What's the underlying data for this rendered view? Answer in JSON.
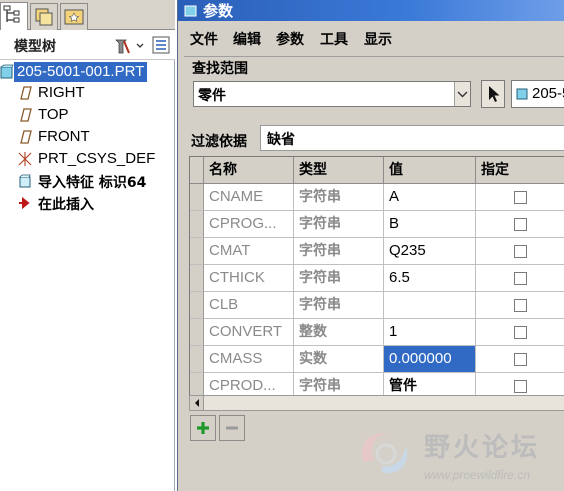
{
  "model_tree": {
    "title": "模型树",
    "root": "205-5001-001.PRT",
    "items": [
      {
        "label": "RIGHT",
        "icon": "datum-plane-icon"
      },
      {
        "label": "TOP",
        "icon": "datum-plane-icon"
      },
      {
        "label": "FRONT",
        "icon": "datum-plane-icon"
      },
      {
        "label": "PRT_CSYS_DEF",
        "icon": "coordinate-system-icon"
      },
      {
        "label": "导入特征 标识64",
        "icon": "import-feature-icon"
      },
      {
        "label": "在此插入",
        "icon": "insert-here-arrow-icon"
      }
    ]
  },
  "dialog": {
    "title": "参数",
    "menu": [
      "文件",
      "编辑",
      "参数",
      "工具",
      "显示"
    ],
    "search_range_label": "查找范围",
    "scope_value": "零件",
    "scope_target": "205-5",
    "filter_label": "过滤依据",
    "filter_value": "缺省",
    "columns": [
      "名称",
      "类型",
      "值",
      "指定"
    ],
    "rows": [
      {
        "name": "CNAME",
        "type": "字符串",
        "value": "A"
      },
      {
        "name": "CPROG...",
        "type": "字符串",
        "value": "B"
      },
      {
        "name": "CMAT",
        "type": "字符串",
        "value": "Q235"
      },
      {
        "name": "CTHICK",
        "type": "字符串",
        "value": "6.5"
      },
      {
        "name": "CLB",
        "type": "字符串",
        "value": ""
      },
      {
        "name": "CONVERT",
        "type": "整数",
        "value": "1"
      },
      {
        "name": "CMASS",
        "type": "实数",
        "value": "0.000000"
      },
      {
        "name": "CPROD...",
        "type": "字符串",
        "value": "管件"
      }
    ]
  },
  "watermark": {
    "name": "野火论坛",
    "url": "www.proewildfire.cn"
  },
  "colors": {
    "selection": "#316ac5",
    "titlebar": "#2a5fb8",
    "dialog_bg": "#d4d0c8"
  }
}
